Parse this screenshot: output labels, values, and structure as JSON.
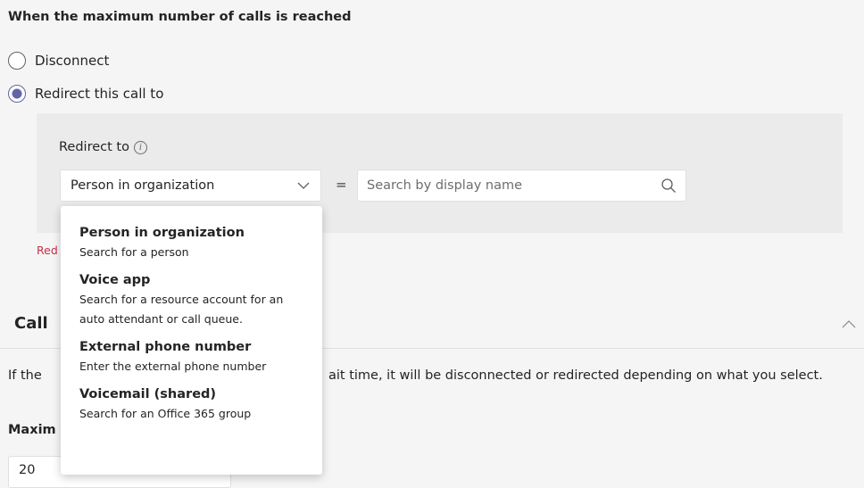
{
  "overflow": {
    "heading": "When the maximum number of calls is reached",
    "options": [
      {
        "label": "Disconnect",
        "selected": false
      },
      {
        "label": "Redirect this call to",
        "selected": true
      }
    ]
  },
  "redirect": {
    "label": "Redirect to",
    "selected_type": "Person in organization",
    "equals": "=",
    "search_placeholder": "Search by display name",
    "error_partial": "Red"
  },
  "dropdown_menu": {
    "items": [
      {
        "title": "Person in organization",
        "desc": "Search for a person"
      },
      {
        "title": "Voice app",
        "desc": "Search for a resource account for an auto attendant or call queue."
      },
      {
        "title": "External phone number",
        "desc": "Enter the external phone number"
      },
      {
        "title": "Voicemail (shared)",
        "desc": "Search for an Office 365 group"
      }
    ]
  },
  "timeout_section": {
    "title_partial": "Call",
    "desc_left": "If the",
    "desc_right": "ait time, it will be disconnected or redirected depending on what you select.",
    "max_label_partial": "Maxim",
    "max_value": "20"
  },
  "colors": {
    "accent": "#6264a7",
    "error": "#c4314b"
  }
}
